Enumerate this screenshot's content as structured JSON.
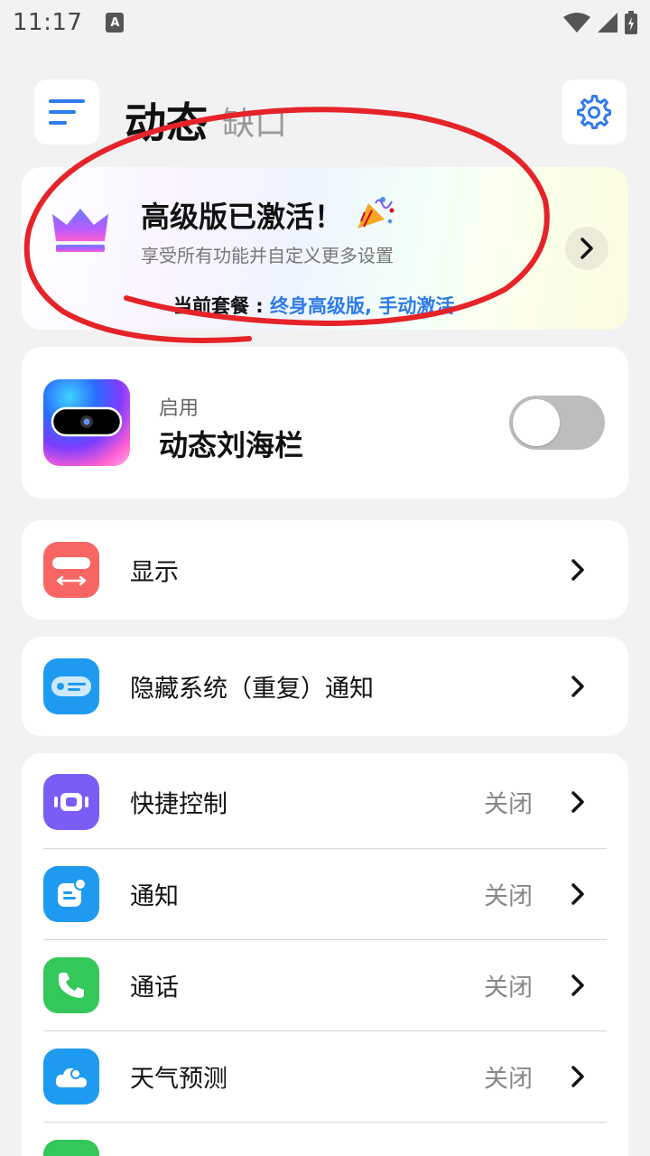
{
  "status_bar": {
    "time": "11:17",
    "a_badge": "A"
  },
  "header": {
    "title": "动态",
    "subtitle": "缺口"
  },
  "premium": {
    "title": "高级版已激活！",
    "subtitle": "享受所有功能并自定义更多设置",
    "plan_label": "当前套餐 : ",
    "plan_value": "终身高级版, 手动激活"
  },
  "enable": {
    "label": "启用",
    "title": "动态刘海栏",
    "enabled": false
  },
  "display": {
    "label": "显示"
  },
  "hide_notif": {
    "label": "隐藏系统（重复）通知"
  },
  "features": [
    {
      "label": "快捷控制",
      "status": "关闭",
      "icon": "quick-control-icon",
      "color": "#7b5cf5"
    },
    {
      "label": "通知",
      "status": "关闭",
      "icon": "notification-icon",
      "color": "#1e9bf0"
    },
    {
      "label": "通话",
      "status": "关闭",
      "icon": "phone-icon",
      "color": "#34c759"
    },
    {
      "label": "天气预测",
      "status": "关闭",
      "icon": "weather-icon",
      "color": "#1e9bf0"
    }
  ],
  "colors": {
    "accent": "#2f7bea",
    "display_icon": "#f86664",
    "annotation": "#e52328"
  }
}
